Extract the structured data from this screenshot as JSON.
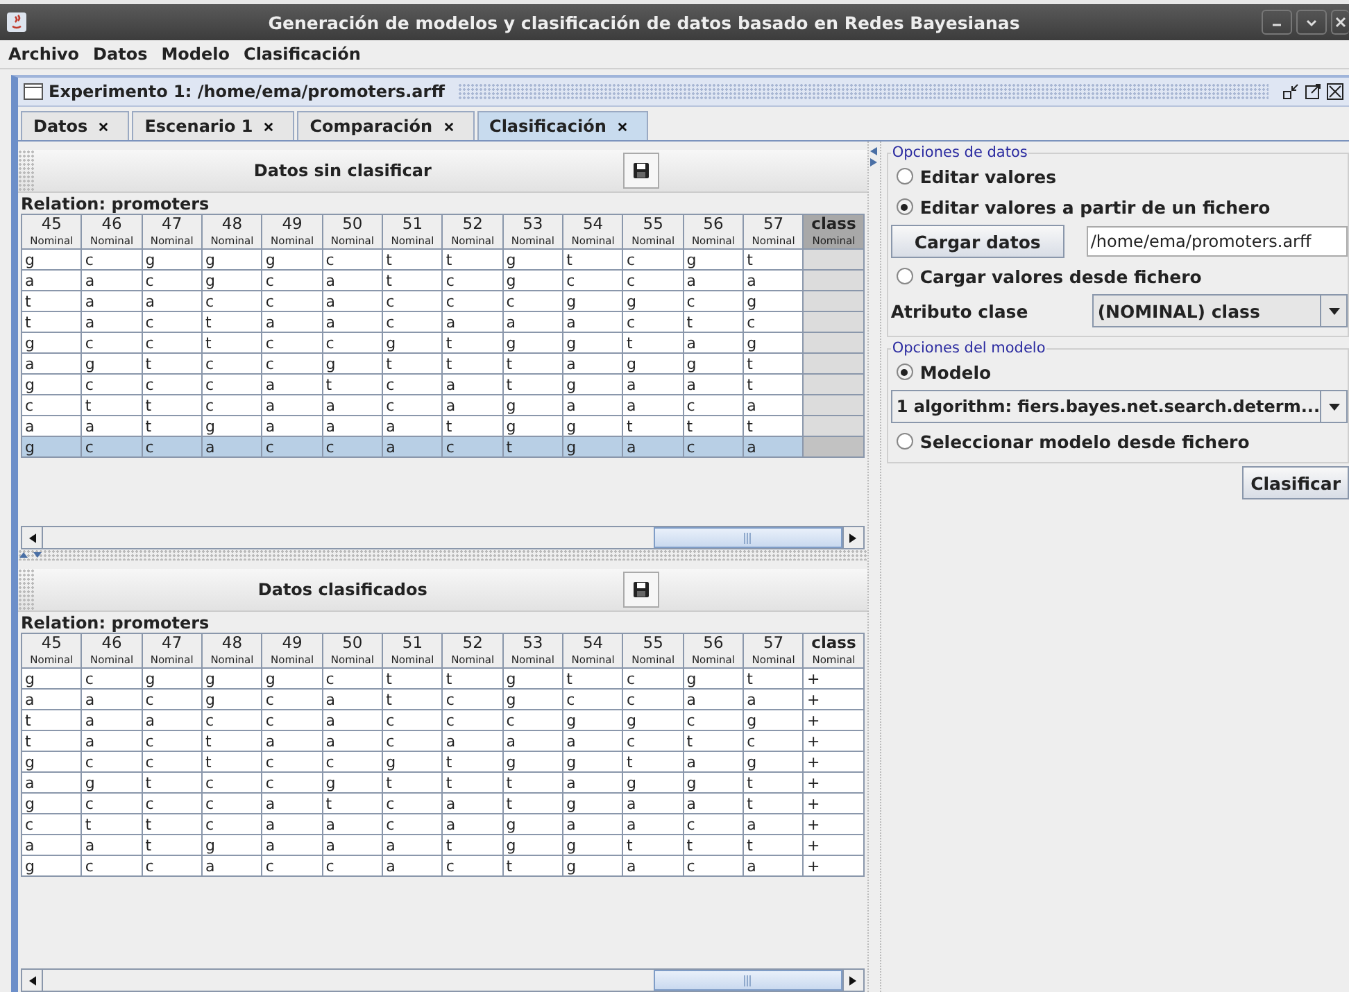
{
  "window": {
    "title": "Generación de modelos y clasificación de datos basado en Redes Bayesianas"
  },
  "menu": [
    "Archivo",
    "Datos",
    "Modelo",
    "Clasificación"
  ],
  "frame": {
    "title": "Experimento 1: /home/ema/promoters.arff"
  },
  "tabs": [
    {
      "label": "Datos",
      "selected": false
    },
    {
      "label": "Escenario 1",
      "selected": false
    },
    {
      "label": "Comparación",
      "selected": false
    },
    {
      "label": "Clasificación",
      "selected": true
    }
  ],
  "panels": [
    {
      "title": "Datos sin clasificar",
      "relation": "Relation: promoters",
      "columns": [
        {
          "name": "45",
          "type": "Nominal",
          "selected": false
        },
        {
          "name": "46",
          "type": "Nominal",
          "selected": false
        },
        {
          "name": "47",
          "type": "Nominal",
          "selected": false
        },
        {
          "name": "48",
          "type": "Nominal",
          "selected": false
        },
        {
          "name": "49",
          "type": "Nominal",
          "selected": false
        },
        {
          "name": "50",
          "type": "Nominal",
          "selected": false
        },
        {
          "name": "51",
          "type": "Nominal",
          "selected": false
        },
        {
          "name": "52",
          "type": "Nominal",
          "selected": false
        },
        {
          "name": "53",
          "type": "Nominal",
          "selected": false
        },
        {
          "name": "54",
          "type": "Nominal",
          "selected": false
        },
        {
          "name": "55",
          "type": "Nominal",
          "selected": false
        },
        {
          "name": "56",
          "type": "Nominal",
          "selected": false
        },
        {
          "name": "57",
          "type": "Nominal",
          "selected": false
        },
        {
          "name": "class",
          "type": "Nominal",
          "selected": true
        }
      ],
      "rows": [
        {
          "cells": [
            "g",
            "c",
            "g",
            "g",
            "g",
            "c",
            "t",
            "t",
            "g",
            "t",
            "c",
            "g",
            "t"
          ],
          "selected": false
        },
        {
          "cells": [
            "a",
            "a",
            "c",
            "g",
            "c",
            "a",
            "t",
            "c",
            "g",
            "c",
            "c",
            "a",
            "a"
          ],
          "selected": false
        },
        {
          "cells": [
            "t",
            "a",
            "a",
            "c",
            "c",
            "a",
            "c",
            "c",
            "c",
            "g",
            "g",
            "c",
            "g"
          ],
          "selected": false
        },
        {
          "cells": [
            "t",
            "a",
            "c",
            "t",
            "a",
            "a",
            "c",
            "a",
            "a",
            "a",
            "c",
            "t",
            "c"
          ],
          "selected": false
        },
        {
          "cells": [
            "g",
            "c",
            "c",
            "t",
            "c",
            "c",
            "g",
            "t",
            "g",
            "g",
            "t",
            "a",
            "g"
          ],
          "selected": false
        },
        {
          "cells": [
            "a",
            "g",
            "t",
            "c",
            "c",
            "g",
            "t",
            "t",
            "t",
            "a",
            "g",
            "g",
            "t"
          ],
          "selected": false
        },
        {
          "cells": [
            "g",
            "c",
            "c",
            "c",
            "a",
            "t",
            "c",
            "a",
            "t",
            "g",
            "a",
            "a",
            "t"
          ],
          "selected": false
        },
        {
          "cells": [
            "c",
            "t",
            "t",
            "c",
            "a",
            "a",
            "c",
            "a",
            "g",
            "a",
            "a",
            "c",
            "a"
          ],
          "selected": false
        },
        {
          "cells": [
            "a",
            "a",
            "t",
            "g",
            "a",
            "a",
            "a",
            "t",
            "g",
            "g",
            "t",
            "t",
            "t"
          ],
          "selected": false
        },
        {
          "cells": [
            "g",
            "c",
            "c",
            "a",
            "c",
            "c",
            "a",
            "c",
            "t",
            "g",
            "a",
            "c",
            "a"
          ],
          "selected": true
        }
      ]
    },
    {
      "title": "Datos clasificados",
      "relation": "Relation: promoters",
      "columns": [
        {
          "name": "45",
          "type": "Nominal",
          "selected": false
        },
        {
          "name": "46",
          "type": "Nominal",
          "selected": false
        },
        {
          "name": "47",
          "type": "Nominal",
          "selected": false
        },
        {
          "name": "48",
          "type": "Nominal",
          "selected": false
        },
        {
          "name": "49",
          "type": "Nominal",
          "selected": false
        },
        {
          "name": "50",
          "type": "Nominal",
          "selected": false
        },
        {
          "name": "51",
          "type": "Nominal",
          "selected": false
        },
        {
          "name": "52",
          "type": "Nominal",
          "selected": false
        },
        {
          "name": "53",
          "type": "Nominal",
          "selected": false
        },
        {
          "name": "54",
          "type": "Nominal",
          "selected": false
        },
        {
          "name": "55",
          "type": "Nominal",
          "selected": false
        },
        {
          "name": "56",
          "type": "Nominal",
          "selected": false
        },
        {
          "name": "57",
          "type": "Nominal",
          "selected": false
        },
        {
          "name": "class",
          "type": "Nominal",
          "selected": false
        }
      ],
      "rows": [
        {
          "cells": [
            "g",
            "c",
            "g",
            "g",
            "g",
            "c",
            "t",
            "t",
            "g",
            "t",
            "c",
            "g",
            "t",
            "+"
          ],
          "selected": false
        },
        {
          "cells": [
            "a",
            "a",
            "c",
            "g",
            "c",
            "a",
            "t",
            "c",
            "g",
            "c",
            "c",
            "a",
            "a",
            "+"
          ],
          "selected": false
        },
        {
          "cells": [
            "t",
            "a",
            "a",
            "c",
            "c",
            "a",
            "c",
            "c",
            "c",
            "g",
            "g",
            "c",
            "g",
            "+"
          ],
          "selected": false
        },
        {
          "cells": [
            "t",
            "a",
            "c",
            "t",
            "a",
            "a",
            "c",
            "a",
            "a",
            "a",
            "c",
            "t",
            "c",
            "+"
          ],
          "selected": false
        },
        {
          "cells": [
            "g",
            "c",
            "c",
            "t",
            "c",
            "c",
            "g",
            "t",
            "g",
            "g",
            "t",
            "a",
            "g",
            "+"
          ],
          "selected": false
        },
        {
          "cells": [
            "a",
            "g",
            "t",
            "c",
            "c",
            "g",
            "t",
            "t",
            "t",
            "a",
            "g",
            "g",
            "t",
            "+"
          ],
          "selected": false
        },
        {
          "cells": [
            "g",
            "c",
            "c",
            "c",
            "a",
            "t",
            "c",
            "a",
            "t",
            "g",
            "a",
            "a",
            "t",
            "+"
          ],
          "selected": false
        },
        {
          "cells": [
            "c",
            "t",
            "t",
            "c",
            "a",
            "a",
            "c",
            "a",
            "g",
            "a",
            "a",
            "c",
            "a",
            "+"
          ],
          "selected": false
        },
        {
          "cells": [
            "a",
            "a",
            "t",
            "g",
            "a",
            "a",
            "a",
            "t",
            "g",
            "g",
            "t",
            "t",
            "t",
            "+"
          ],
          "selected": false
        },
        {
          "cells": [
            "g",
            "c",
            "c",
            "a",
            "c",
            "c",
            "a",
            "c",
            "t",
            "g",
            "a",
            "c",
            "a",
            "+"
          ],
          "selected": false
        }
      ]
    }
  ],
  "option_groups": [
    {
      "title": "Opciones de datos",
      "items": [
        {
          "kind": "radio",
          "label": "Editar valores",
          "selected": false
        },
        {
          "kind": "radio",
          "label": "Editar valores a partir de un fichero",
          "selected": true
        },
        {
          "kind": "file",
          "button": "Cargar datos",
          "value": "/home/ema/promoters.arff"
        },
        {
          "kind": "radio",
          "label": "Cargar valores desde fichero",
          "selected": false
        },
        {
          "kind": "combo",
          "label": "Atributo clase",
          "value": "(NOMINAL) class"
        }
      ]
    },
    {
      "title": "Opciones del modelo",
      "items": [
        {
          "kind": "radio",
          "label": "Modelo",
          "selected": true
        },
        {
          "kind": "combo",
          "value": "1 algorithm: fiers.bayes.net.search.determ..."
        },
        {
          "kind": "radio",
          "label": "Seleccionar modelo desde fichero",
          "selected": false
        }
      ]
    }
  ],
  "action_button": "Clasificar"
}
